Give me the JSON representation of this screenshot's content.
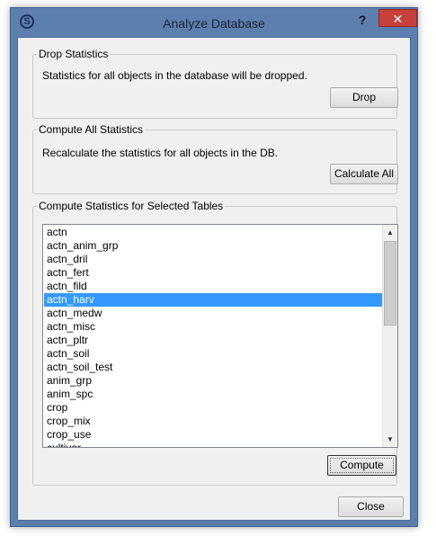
{
  "window": {
    "title": "Analyze Database",
    "help_label": "?",
    "close_label": "✕"
  },
  "drop": {
    "group_title": "Drop Statistics",
    "description": "Statistics for all objects in the database will be dropped.",
    "button_label": "Drop"
  },
  "compute_all": {
    "group_title": "Compute All Statistics",
    "description": "Recalculate the statistics for all objects in the DB.",
    "button_label": "Calculate All"
  },
  "compute_selected": {
    "group_title": "Compute Statistics for Selected Tables",
    "tables": [
      "actn",
      "actn_anim_grp",
      "actn_dril",
      "actn_fert",
      "actn_fild",
      "actn_harv",
      "actn_medw",
      "actn_misc",
      "actn_pltr",
      "actn_soil",
      "actn_soil_test",
      "anim_grp",
      "anim_spc",
      "crop",
      "crop_mix",
      "crop_use",
      "cultivar"
    ],
    "selected_table": "actn_harv",
    "button_label": "Compute"
  },
  "footer": {
    "close_label": "Close"
  },
  "icons": {
    "app": "app-logo-icon",
    "scroll_up": "scroll-up-icon",
    "scroll_down": "scroll-down-icon"
  },
  "colors": {
    "selection": "#3399ff",
    "title_bar": "#5c7fb0",
    "close_button": "#c7413a"
  }
}
